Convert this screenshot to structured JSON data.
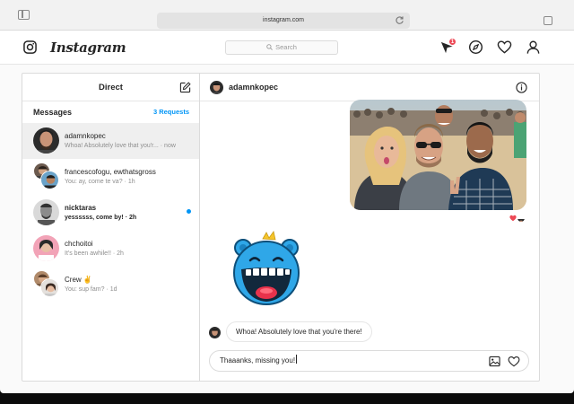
{
  "browser": {
    "url": "instagram.com"
  },
  "header": {
    "brand": "Instagram",
    "search_placeholder": "Search",
    "notification_badge": "1"
  },
  "inbox": {
    "title": "Direct",
    "section_label": "Messages",
    "requests_label": "3 Requests",
    "threads": [
      {
        "name": "adamnkopec",
        "preview": "Whoa! Absolutely love that you'r... · now",
        "active": true,
        "unread": false
      },
      {
        "name": "francescofogu, ewthatsgross",
        "preview": "You: ay, come te va? · 1h",
        "active": false,
        "unread": false
      },
      {
        "name": "nicktaras",
        "preview": "yessssss, come by! · 2h",
        "active": false,
        "unread": true
      },
      {
        "name": "chchoitoi",
        "preview": "It's been awhile!! · 2h",
        "active": false,
        "unread": false
      },
      {
        "name": "Crew ✌️",
        "preview": "You: sup fam? · 1d",
        "active": false,
        "unread": false
      }
    ]
  },
  "conversation": {
    "username": "adamnkopec",
    "incoming_message": "Whoa! Absolutely love that you're there!",
    "composer_text": "Thaaanks, missing you!"
  },
  "colors": {
    "accent": "#0095f6",
    "badge": "#ed4956",
    "sticker_blue": "#2fa7e8"
  }
}
